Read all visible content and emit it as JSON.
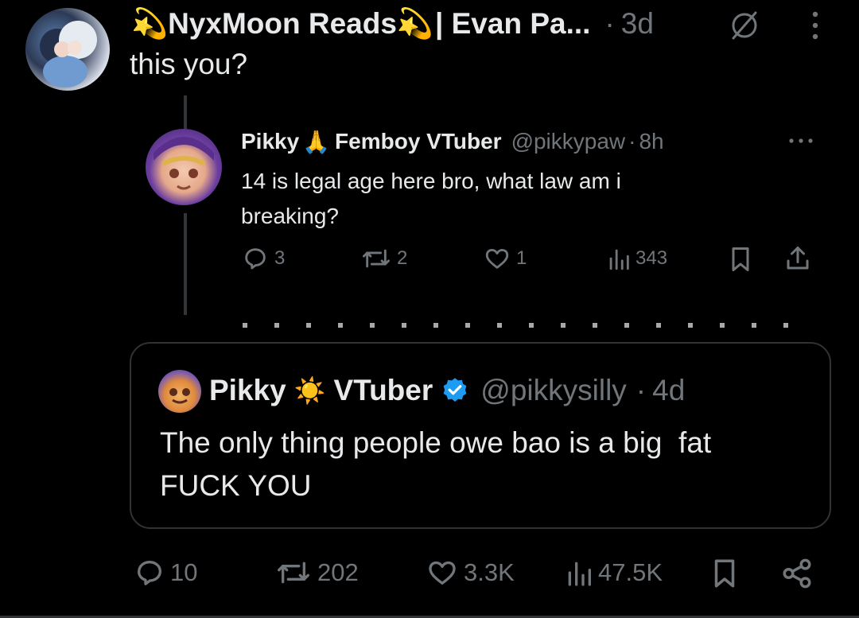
{
  "main_post": {
    "display_name": "NyxMoon Reads",
    "name_suffix": "| Evan Pa...",
    "dot": "·",
    "time": "3d",
    "text": "this you?",
    "name_emoji": "💫"
  },
  "screenshot": {
    "display_name": "Pikky",
    "name_emoji": "🙏",
    "name_rest": "Femboy VTuber",
    "handle": "@pikkypaw",
    "dot": "·",
    "time": "8h",
    "text_line1": "14 is legal age here bro, what law am i",
    "text_line2": "breaking?",
    "replies": "3",
    "reposts": "2",
    "likes": "1",
    "views": "343"
  },
  "quote": {
    "display_name": "Pikky",
    "name_emoji": "☀️",
    "name_rest": "VTuber",
    "handle": "@pikkysilly",
    "dot": "·",
    "time": "4d",
    "text_line1": "The only thing people owe bao is a big  fat",
    "text_line2": "FUCK YOU"
  },
  "actions": {
    "replies": "10",
    "reposts": "202",
    "likes": "3.3K",
    "views": "47.5K"
  },
  "colors": {
    "background": "#000000",
    "text": "#e7e9ea",
    "muted": "#71767b",
    "border": "#2f3336",
    "verified": "#1d9bf0"
  },
  "icons": [
    "grok-icon",
    "more-icon",
    "reply-icon",
    "repost-icon",
    "like-icon",
    "views-icon",
    "bookmark-icon",
    "share-icon",
    "verified-icon"
  ]
}
